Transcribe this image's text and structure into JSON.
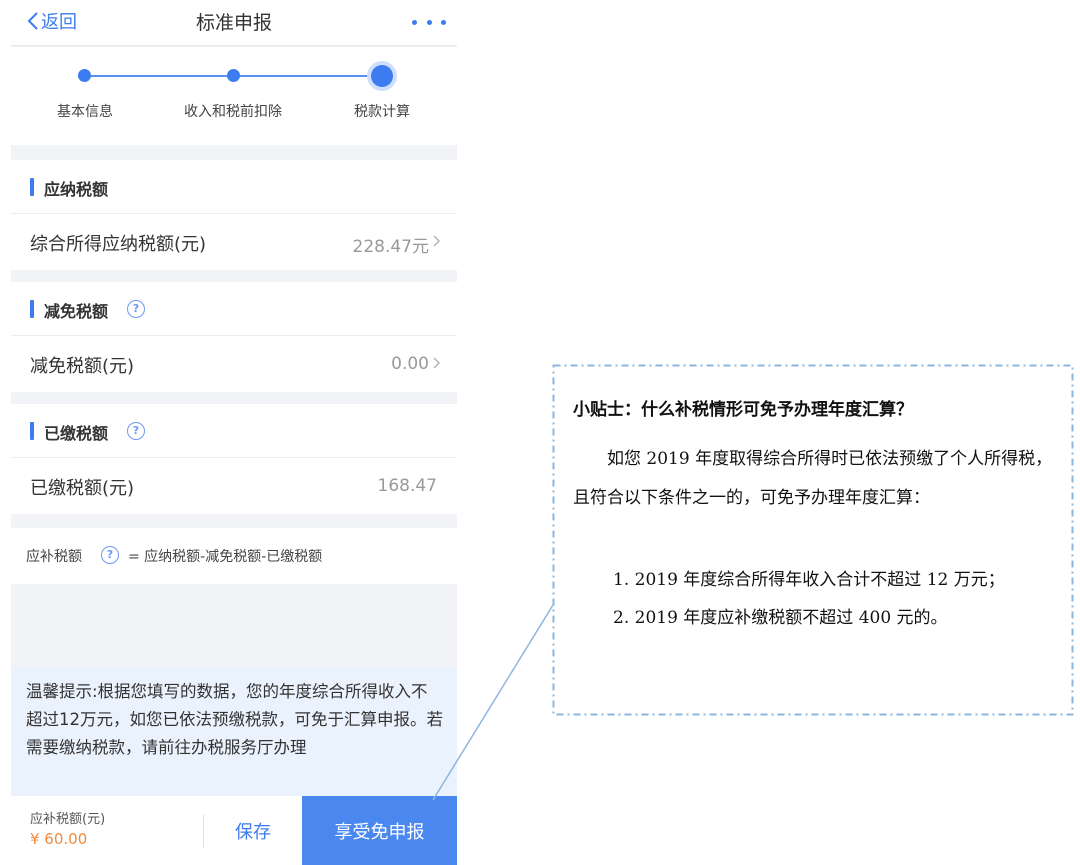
{
  "nav": {
    "back_label": "返回",
    "title": "标准申报"
  },
  "steps": [
    {
      "label": "基本信息",
      "state": "done"
    },
    {
      "label": "收入和税前扣除",
      "state": "done"
    },
    {
      "label": "税款计算",
      "state": "current"
    }
  ],
  "sections": {
    "payable": {
      "title": "应纳税额",
      "row_label": "综合所得应纳税额(元)",
      "row_value": "228.47元"
    },
    "reduction": {
      "title": "减免税额",
      "row_label": "减免税额(元)",
      "row_value": "0.00"
    },
    "paid": {
      "title": "已缴税额",
      "row_label": "已缴税额(元)",
      "row_value": "168.47"
    }
  },
  "formula": {
    "label": "应补税额",
    "text": "= 应纳税额-减免税额-已缴税额"
  },
  "tip": {
    "text": "温馨提示:根据您填写的数据，您的年度综合所得收入不超过12万元，如您已依法预缴税款，可免于汇算申报。若需要缴纳税款，请前往办税服务厅办理"
  },
  "footer": {
    "label": "应补税额(元)",
    "amount": "¥ 60.00",
    "save_label": "保存",
    "submit_label": "享受免申报"
  },
  "callout": {
    "title": "小贴士：什么补税情形可免予办理年度汇算？",
    "body": "如您 2019 年度取得综合所得时已依法预缴了个人所得税，且符合以下条件之一的，可免予办理年度汇算：",
    "items": [
      "1. 2019 年度综合所得年收入合计不超过 12 万元；",
      "2. 2019 年度应补缴税额不超过 400 元的。"
    ]
  },
  "colors": {
    "accent": "#3d7bf0",
    "amount": "#f08a3c",
    "tip_background": "#eaf2fd",
    "callout_border": "#8db6dd"
  },
  "icons": [
    "chevron-left-icon",
    "more-dots-icon",
    "question-circle-icon",
    "chevron-right-icon"
  ]
}
